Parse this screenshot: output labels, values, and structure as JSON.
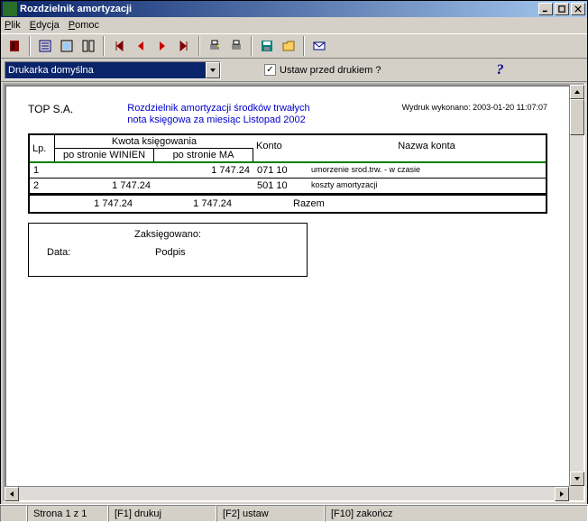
{
  "window": {
    "title": "Rozdzielnik amortyzacji"
  },
  "menu": {
    "file": "Plik",
    "edit": "Edycja",
    "help": "Pomoc"
  },
  "printerCombo": {
    "value": "Drukarka domyślna"
  },
  "setBeforePrint": {
    "label": "Ustaw przed drukiem ?",
    "checked": true
  },
  "doc": {
    "company": "TOP S.A.",
    "title1": "Rozdzielnik amortyzacji środków trwałych",
    "title2": "nota księgowa za miesiąc Listopad 2002",
    "printInfo": "Wydruk wykonano: 2003-01-20 11:07:07",
    "headers": {
      "lp": "Lp.",
      "kwota": "Kwota księgowania",
      "winien": "po stronie WINIEN",
      "ma": "po stronie MA",
      "konto": "Konto",
      "nazwa": "Nazwa konta"
    },
    "rows": [
      {
        "lp": "1",
        "winien": "",
        "ma": "1 747.24",
        "konto": "071 10",
        "nazwa": "umorzenie srod.trw. - w czasie"
      },
      {
        "lp": "2",
        "winien": "1 747.24",
        "ma": "",
        "konto": "501 10",
        "nazwa": "koszty amortyzacji"
      }
    ],
    "total": {
      "winien": "1 747.24",
      "ma": "1 747.24",
      "label": "Razem"
    },
    "sig": {
      "booked": "Zaksięgowano:",
      "date": "Data:",
      "sign": "Podpis"
    }
  },
  "status": {
    "page": "Strona 1 z 1",
    "f1": "[F1] drukuj",
    "f2": "[F2] ustaw",
    "f10": "[F10] zakończ"
  }
}
